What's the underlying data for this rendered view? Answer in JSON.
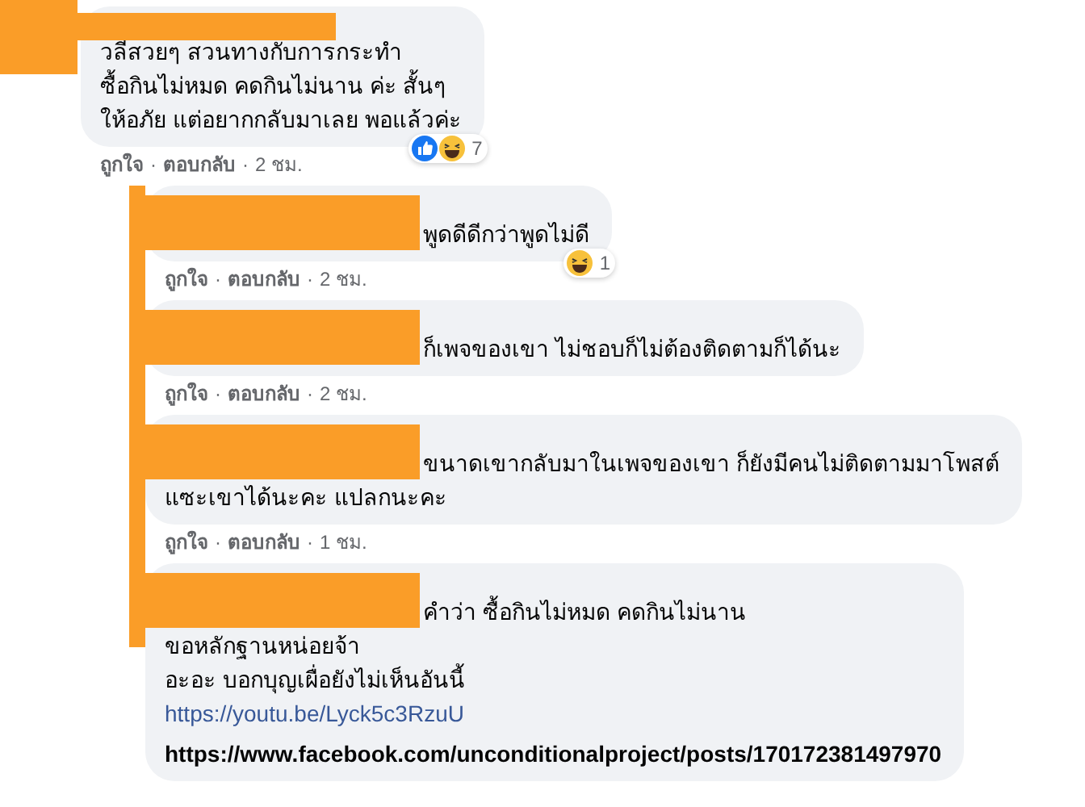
{
  "comments": [
    {
      "reply": false,
      "lines": [
        "วลีสวยๆ สวนทางกับการกระทำ",
        "ซื้อกินไม่หมด คดกินไม่นาน ค่ะ สั้นๆ",
        "ให้อภัย แต่อยากกลับมาเลย พอแล้วค่ะ"
      ],
      "reactions": {
        "icons": [
          {
            "kind": "like"
          },
          {
            "kind": "haha"
          }
        ],
        "count": "7"
      },
      "actions": [
        {
          "kind": "like",
          "text": "ถูกใจ"
        },
        {
          "kind": "separator",
          "text": "·"
        },
        {
          "kind": "reply",
          "text": "ตอบกลับ"
        },
        {
          "kind": "separator",
          "text": "·"
        },
        {
          "kind": "time",
          "text": "2 ชม."
        }
      ]
    },
    {
      "reply": true,
      "lines": [
        "พูดดีดีกว่าพูดไม่ดี"
      ],
      "reactions": {
        "icons": [
          {
            "kind": "haha"
          }
        ],
        "count": "1"
      },
      "actions": [
        {
          "kind": "like",
          "text": "ถูกใจ"
        },
        {
          "kind": "separator",
          "text": "·"
        },
        {
          "kind": "reply",
          "text": "ตอบกลับ"
        },
        {
          "kind": "separator",
          "text": "·"
        },
        {
          "kind": "time",
          "text": "2 ชม."
        }
      ]
    },
    {
      "reply": true,
      "lines": [
        "ก็เพจของเขา ไม่ชอบก็ไม่ต้องติดตามก็ได้นะ"
      ],
      "actions": [
        {
          "kind": "like",
          "text": "ถูกใจ"
        },
        {
          "kind": "separator",
          "text": "·"
        },
        {
          "kind": "reply",
          "text": "ตอบกลับ"
        },
        {
          "kind": "separator",
          "text": "·"
        },
        {
          "kind": "time",
          "text": "2 ชม."
        }
      ]
    },
    {
      "reply": true,
      "lines": [
        "ขนาดเขากลับมาในเพจของเขา ก็ยังมีคนไม่ติดตามมาโพสต์",
        "แซะเขาได้นะคะ แปลกนะคะ"
      ],
      "actions": [
        {
          "kind": "like",
          "text": "ถูกใจ"
        },
        {
          "kind": "separator",
          "text": "·"
        },
        {
          "kind": "reply",
          "text": "ตอบกลับ"
        },
        {
          "kind": "separator",
          "text": "·"
        },
        {
          "kind": "time",
          "text": "1 ชม."
        }
      ]
    },
    {
      "reply": true,
      "lines": [
        "คำว่า ซื้อกินไม่หมด คดกินไม่นาน",
        "ขอหลักฐานหน่อยจ้า",
        "อะอะ บอกบุญเผื่อยังไม่เห็นอันนี้"
      ],
      "links": [
        {
          "text": "https://youtu.be/Lyck5c3RzuU",
          "kind": "link"
        },
        {
          "text": "https://www.facebook.com/unconditionalproject/posts/170172381497970",
          "kind": "preview"
        }
      ]
    }
  ]
}
